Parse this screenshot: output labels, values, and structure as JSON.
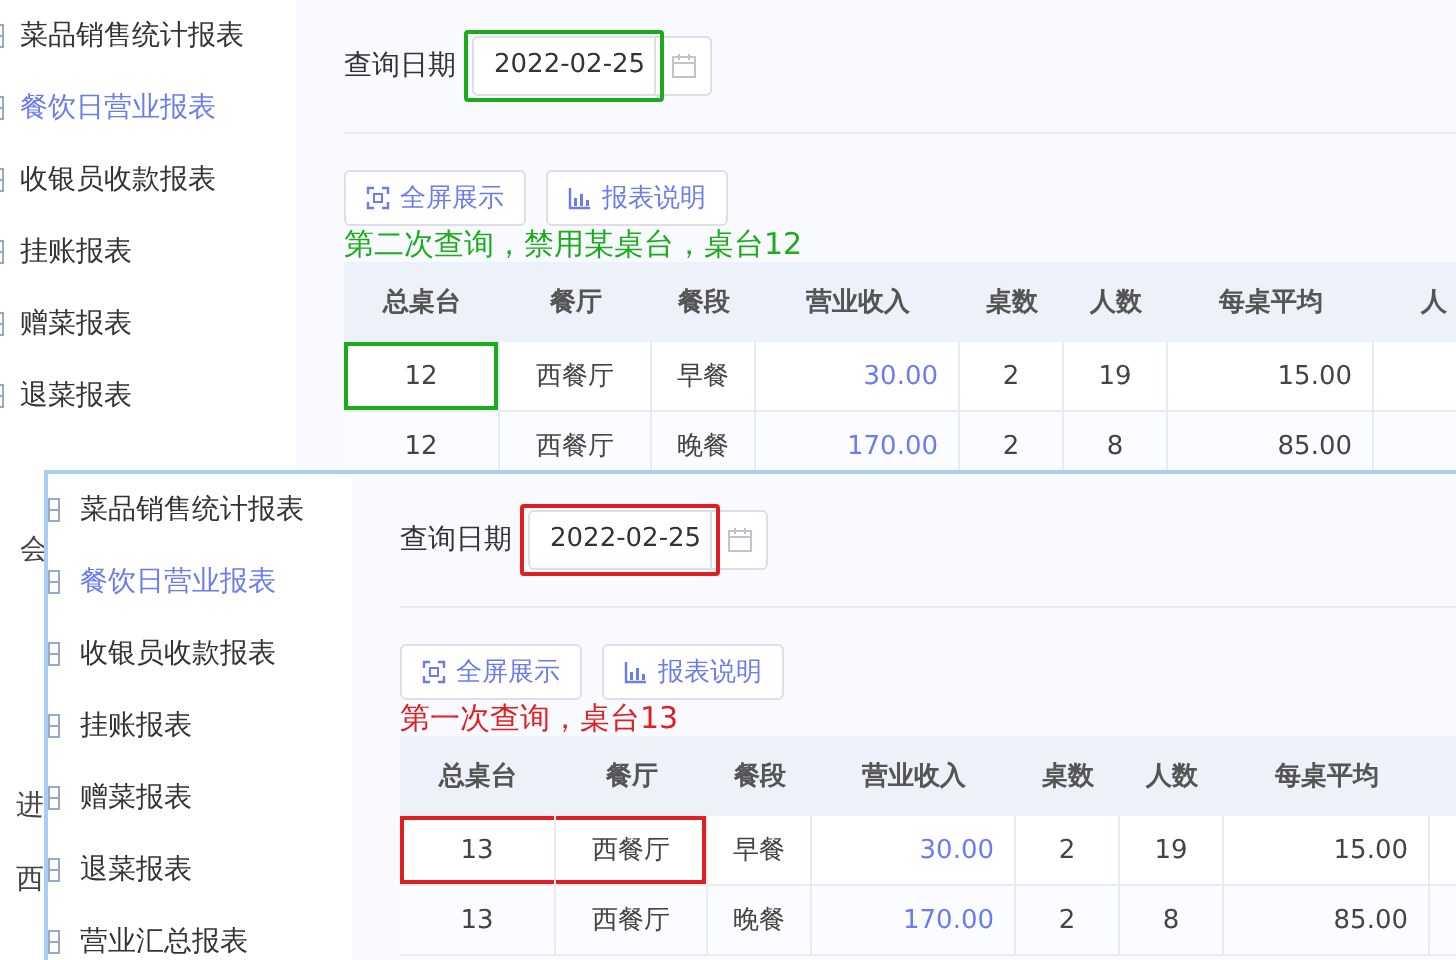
{
  "behind_fragments": [
    "会",
    "进",
    "西"
  ],
  "shots": [
    {
      "sidebar": {
        "items": [
          {
            "label": "菜品销售统计报表",
            "selected": false
          },
          {
            "label": "餐饮日营业报表",
            "selected": true
          },
          {
            "label": "收银员收款报表",
            "selected": false
          },
          {
            "label": "挂账报表",
            "selected": false
          },
          {
            "label": "赠菜报表",
            "selected": false
          },
          {
            "label": "退菜报表",
            "selected": false
          }
        ]
      },
      "date_label": "查询日期",
      "date_field": {
        "value": "2022-02-25",
        "highlighted": true
      },
      "buttons": [
        {
          "kind": "fullscreen",
          "label": "全屏展示"
        },
        {
          "kind": "chart",
          "label": "报表说明"
        }
      ],
      "annotation": {
        "text": "第二次查询，禁用某桌台，桌台12",
        "color": "#1aad19"
      },
      "table": {
        "columns": [
          "总桌台",
          "餐厅",
          "餐段",
          "营业收入",
          "桌数",
          "人数",
          "每桌平均",
          "人"
        ],
        "rows": [
          {
            "cells": [
              {
                "text": "12",
                "highlighted": true
              },
              {
                "text": "西餐厅",
                "highlighted": false
              },
              {
                "text": "早餐",
                "highlighted": false
              },
              {
                "text": "30.00",
                "highlighted": false
              },
              {
                "text": "2",
                "highlighted": false
              },
              {
                "text": "19",
                "highlighted": false
              },
              {
                "text": "15.00",
                "highlighted": false
              }
            ]
          },
          {
            "cells": [
              {
                "text": "12",
                "highlighted": false
              },
              {
                "text": "西餐厅",
                "highlighted": false
              },
              {
                "text": "晚餐",
                "highlighted": false
              },
              {
                "text": "170.00",
                "highlighted": false
              },
              {
                "text": "2",
                "highlighted": false
              },
              {
                "text": "8",
                "highlighted": false
              },
              {
                "text": "85.00",
                "highlighted": false
              }
            ]
          }
        ]
      }
    },
    {
      "sidebar": {
        "items": [
          {
            "label": "菜品销售统计报表",
            "selected": false
          },
          {
            "label": "餐饮日营业报表",
            "selected": true
          },
          {
            "label": "收银员收款报表",
            "selected": false
          },
          {
            "label": "挂账报表",
            "selected": false
          },
          {
            "label": "赠菜报表",
            "selected": false
          },
          {
            "label": "退菜报表",
            "selected": false
          },
          {
            "label": "营业汇总报表",
            "selected": false
          }
        ]
      },
      "date_label": "查询日期",
      "date_field": {
        "value": "2022-02-25",
        "highlighted": true
      },
      "buttons": [
        {
          "kind": "fullscreen",
          "label": "全屏展示"
        },
        {
          "kind": "chart",
          "label": "报表说明"
        }
      ],
      "annotation": {
        "text": "第一次查询，桌台13",
        "color": "#e02020"
      },
      "table": {
        "columns": [
          "总桌台",
          "餐厅",
          "餐段",
          "营业收入",
          "桌数",
          "人数",
          "每桌平均"
        ],
        "rows": [
          {
            "cells": [
              {
                "text": "13",
                "highlighted": true
              },
              {
                "text": "西餐厅",
                "highlighted": true
              },
              {
                "text": "早餐",
                "highlighted": false
              },
              {
                "text": "30.00",
                "highlighted": false
              },
              {
                "text": "2",
                "highlighted": false
              },
              {
                "text": "19",
                "highlighted": false
              },
              {
                "text": "15.00",
                "highlighted": false
              }
            ]
          },
          {
            "cells": [
              {
                "text": "13",
                "highlighted": false
              },
              {
                "text": "西餐厅",
                "highlighted": false
              },
              {
                "text": "晚餐",
                "highlighted": false
              },
              {
                "text": "170.00",
                "highlighted": false
              },
              {
                "text": "2",
                "highlighted": false
              },
              {
                "text": "8",
                "highlighted": false
              },
              {
                "text": "85.00",
                "highlighted": false
              }
            ]
          }
        ]
      }
    }
  ]
}
